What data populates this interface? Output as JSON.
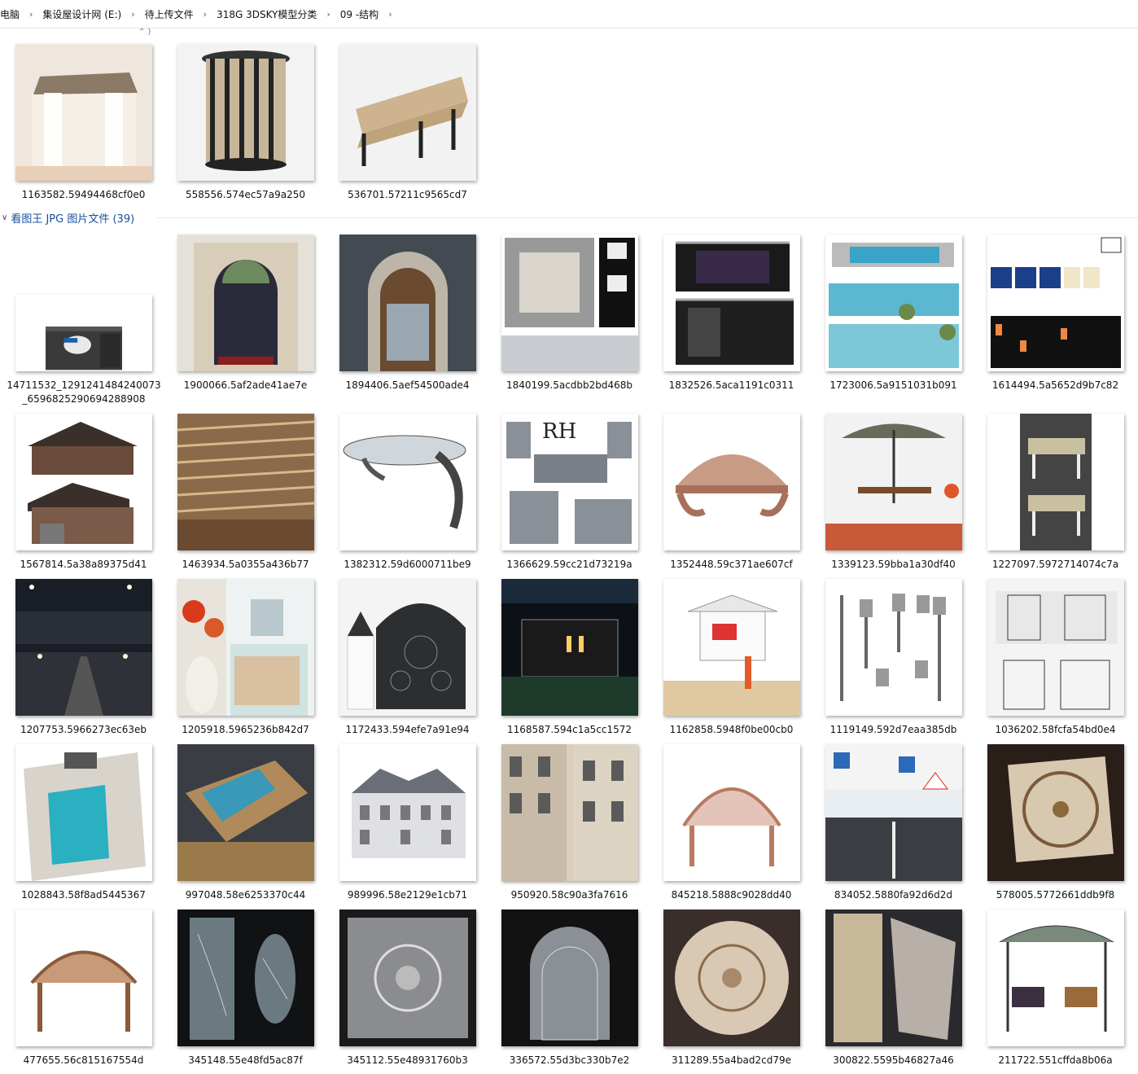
{
  "breadcrumb": [
    "电脑",
    "集设屋设计网 (E:)",
    "待上传文件",
    "318G 3DSKY模型分类",
    "09 -结构"
  ],
  "group_jpg": {
    "label": "看图王 JPG 图片文件 (39)"
  },
  "files_top": [
    {
      "name": "1163582.59494468cf0e0",
      "art": "gazebo"
    },
    {
      "name": "558556.574ec57a9a250",
      "art": "bin"
    },
    {
      "name": "536701.57211c9565cd7",
      "art": "bench"
    }
  ],
  "files_jpg": [
    {
      "name": "14711532_1291241484240073_6596825290694288908",
      "name2": "6596825290694288908",
      "art": "screen"
    },
    {
      "name": "1900066.5af2ade41ae7e",
      "art": "door"
    },
    {
      "name": "1894406.5aef54500ade4",
      "art": "door-dark"
    },
    {
      "name": "1840199.5acdbb2bd468b",
      "art": "stones"
    },
    {
      "name": "1832526.5aca1191c0311",
      "art": "stage"
    },
    {
      "name": "1723006.5a9151031b091",
      "art": "pool"
    },
    {
      "name": "1614494.5a5652d9b7c82",
      "art": "signs"
    },
    {
      "name": "1567814.5a38a89375d41",
      "art": "house"
    },
    {
      "name": "1463934.5a0355a436b77",
      "art": "ceiling"
    },
    {
      "name": "1382312.59d6000711be9",
      "art": "canopy"
    },
    {
      "name": "1366629.59cc21d73219a",
      "art": "rh"
    },
    {
      "name": "1352448.59c371ae607cf",
      "art": "awning"
    },
    {
      "name": "1339123.59bba1a30df40",
      "art": "umbrella"
    },
    {
      "name": "1227097.5972714074c7a",
      "art": "pergola"
    },
    {
      "name": "1207753.5966273ec63eb",
      "art": "road-night"
    },
    {
      "name": "1205918.5965236b842d7",
      "art": "bath"
    },
    {
      "name": "1172433.594efe7a91e94",
      "art": "gate"
    },
    {
      "name": "1168587.594c1a5cc1572",
      "art": "night-pergola"
    },
    {
      "name": "1162858.5948f0be00cb0",
      "art": "lifeguard"
    },
    {
      "name": "1119149.592d7eaa385db",
      "art": "lamps"
    },
    {
      "name": "1036202.58fcfa54bd0e4",
      "art": "fence"
    },
    {
      "name": "1028843.58f8ad5445367",
      "art": "pool-top"
    },
    {
      "name": "997048.58e6253370c44",
      "art": "pool-deck"
    },
    {
      "name": "989996.58e2129e1cb71",
      "art": "mansion"
    },
    {
      "name": "950920.58c90a3fa7616",
      "art": "facade"
    },
    {
      "name": "845218.5888c9028dd40",
      "art": "arch-canopy"
    },
    {
      "name": "834052.5880fa92d6d2d",
      "art": "road-day"
    },
    {
      "name": "578005.5772661ddb9f8",
      "art": "glass-square"
    },
    {
      "name": "477655.56c815167554d",
      "art": "arch-canopy2"
    },
    {
      "name": "345148.55e48fd5ac87f",
      "art": "glass-panels"
    },
    {
      "name": "345112.55e48931760b3",
      "art": "glass-ornate"
    },
    {
      "name": "336572.55d3bc330b7e2",
      "art": "glass-arch"
    },
    {
      "name": "311289.55a4bad2cd79e",
      "art": "glass-round"
    },
    {
      "name": "300822.5595b46827a46",
      "art": "glass-tall"
    },
    {
      "name": "211722.551cffda8b06a",
      "art": "swing"
    }
  ],
  "watermark": "3dsky"
}
